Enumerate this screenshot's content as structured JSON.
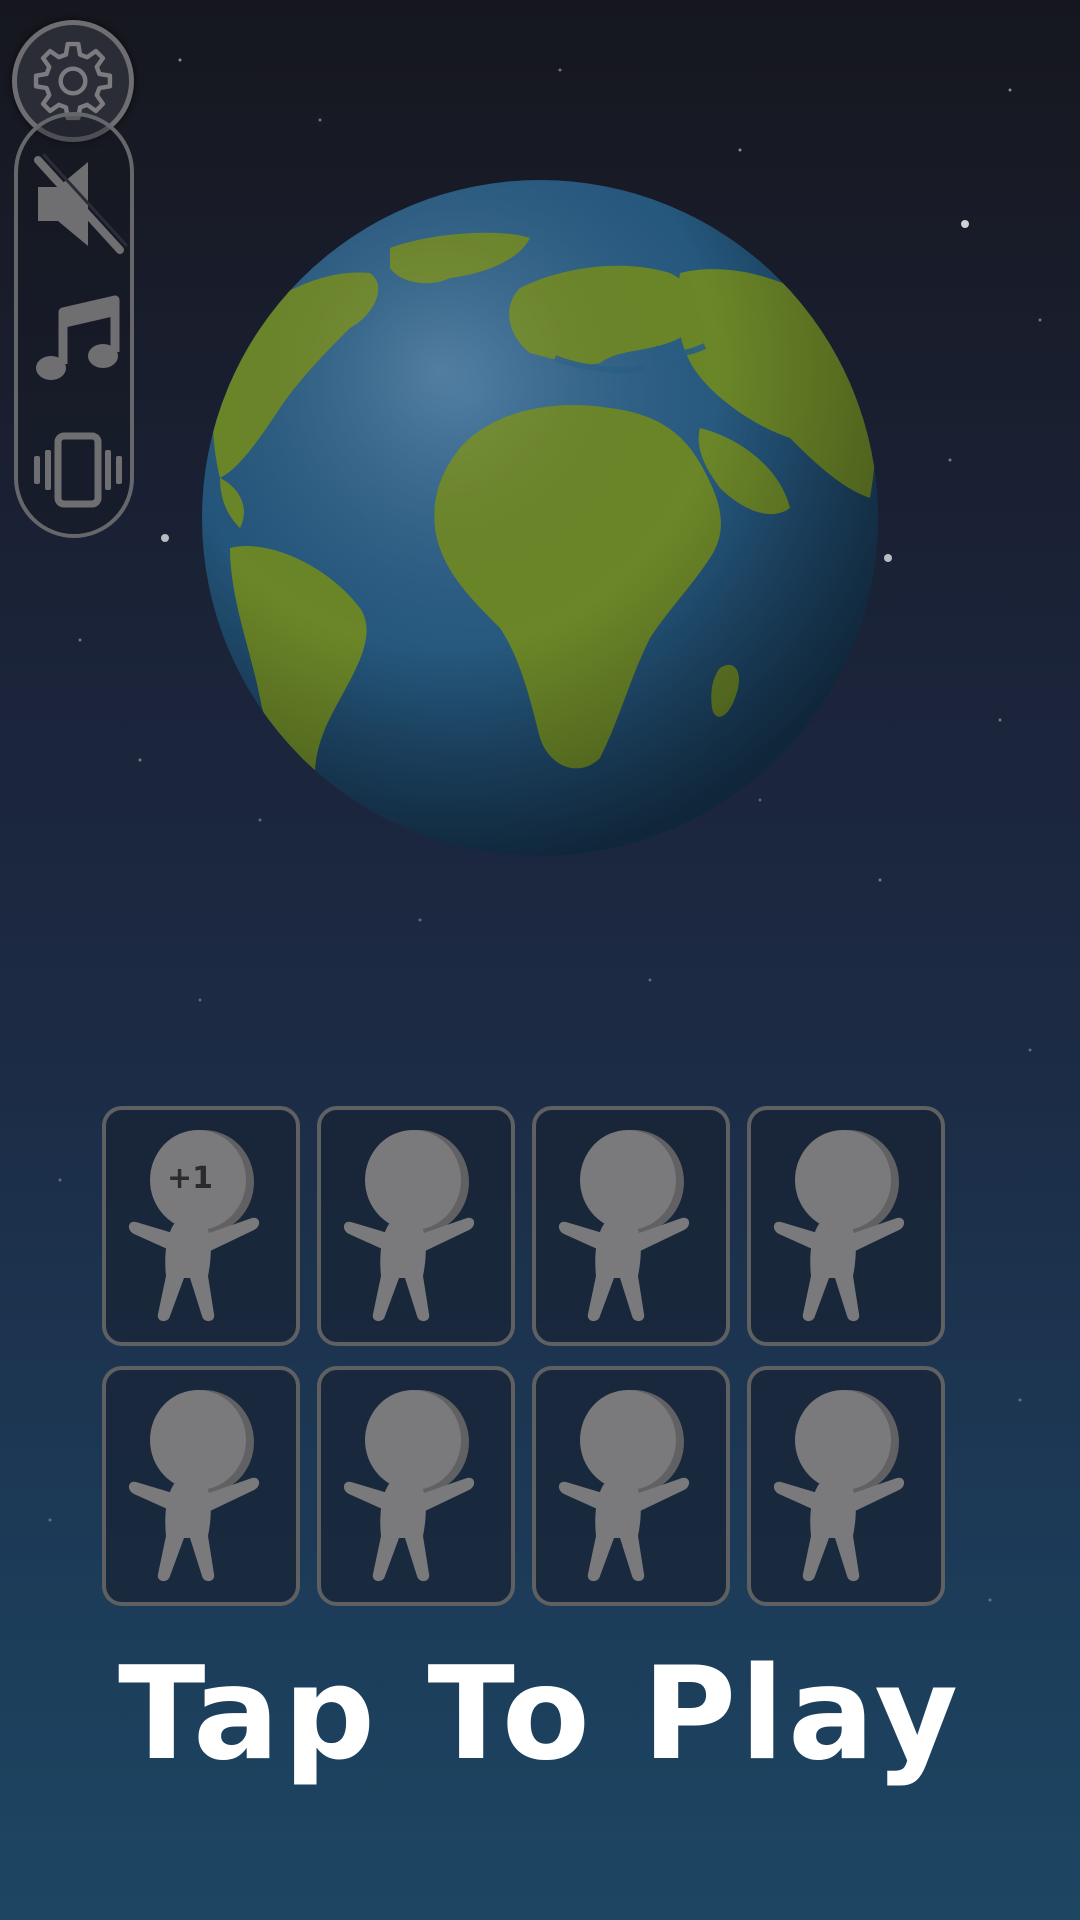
{
  "controls": {
    "settings_icon": "gear-icon",
    "sound_icon": "speaker-muted-icon",
    "music_icon": "music-note-icon",
    "vibration_icon": "vibration-icon"
  },
  "globe": {
    "icon": "earth-globe"
  },
  "characters": [
    {
      "label": "+1"
    },
    {
      "label": ""
    },
    {
      "label": ""
    },
    {
      "label": ""
    },
    {
      "label": ""
    },
    {
      "label": ""
    },
    {
      "label": ""
    },
    {
      "label": ""
    }
  ],
  "play_prompt": "Tap To Play",
  "colors": {
    "background_top": "#16171e",
    "background_bottom": "#1d4663",
    "ocean": "#2a5f86",
    "land": "#6f8a2a",
    "character": "#7a7a7c",
    "slot_border": "#5f6062",
    "text": "#ffffff"
  }
}
